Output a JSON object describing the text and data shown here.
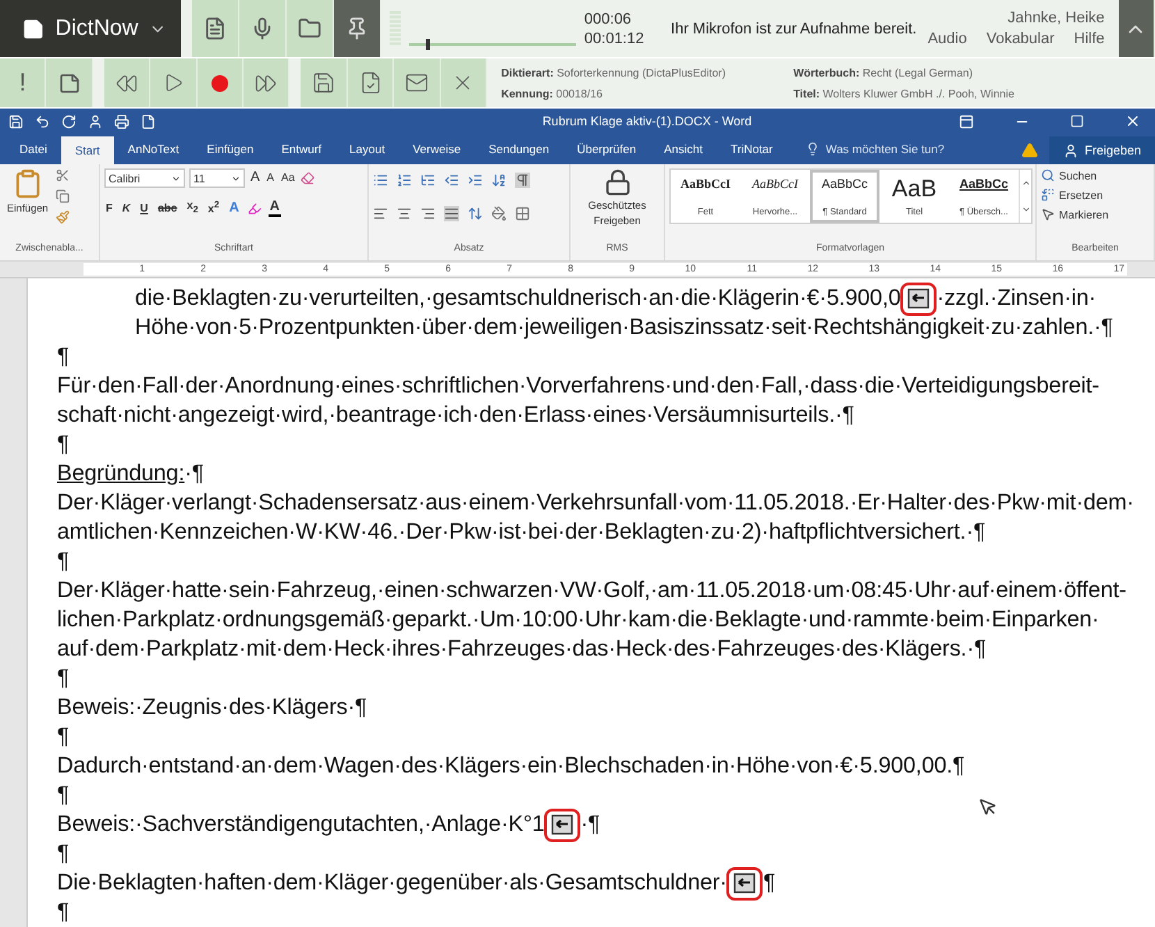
{
  "dictnow": {
    "app_name": "DictNow",
    "pin_active": true,
    "playback": {
      "level": 0.1
    },
    "time_elapsed": "000:06",
    "time_total": "00:01:12",
    "status": "Ihr Mikrofon ist zur Aufnahme bereit.",
    "user": "Jahnke, Heike",
    "menu": [
      "Audio",
      "Vokabular",
      "Hilfe"
    ],
    "priority": "!",
    "info": [
      {
        "label": "Diktierart:",
        "value": "Soforterkennung (DictaPlusEditor)"
      },
      {
        "label": "Wörterbuch:",
        "value": "Recht (Legal German)"
      },
      {
        "label": "Kennung:",
        "value": "00018/16"
      },
      {
        "label": "Titel:",
        "value": "Wolters Kluwer GmbH ./. Pooh, Winnie"
      }
    ]
  },
  "word": {
    "title": "Rubrum Klage aktiv-(1).DOCX - Word",
    "tabs": [
      {
        "label": "Datei",
        "selected": false
      },
      {
        "label": "Start",
        "selected": true
      },
      {
        "label": "AnNoText",
        "selected": false
      },
      {
        "label": "Einfügen",
        "selected": false
      },
      {
        "label": "Entwurf",
        "selected": false
      },
      {
        "label": "Layout",
        "selected": false
      },
      {
        "label": "Verweise",
        "selected": false
      },
      {
        "label": "Sendungen",
        "selected": false
      },
      {
        "label": "Überprüfen",
        "selected": false
      },
      {
        "label": "Ansicht",
        "selected": false
      },
      {
        "label": "TriNotar",
        "selected": false
      }
    ],
    "tell_me": "Was möchten Sie tun?",
    "share": "Freigeben",
    "paste": "Einfügen",
    "font": "Calibri",
    "size": "11",
    "case_button": "Aa",
    "grow": "A",
    "shrink": "A",
    "format_buttons": [
      "F",
      "K",
      "U",
      "abc",
      "x$_{2}$",
      "x$^{2}$"
    ],
    "effect_letter": "A",
    "color_letter": "A",
    "rms": [
      "Geschütztes",
      "Freigeben"
    ],
    "styles": [
      {
        "kind": "bold",
        "preview": "AaBbCcI",
        "name": "Fett",
        "selected": false
      },
      {
        "kind": "italic",
        "preview": "AaBbCcI",
        "name": "Hervorhe...",
        "selected": false
      },
      {
        "kind": "normal",
        "preview": "AaBbCc",
        "name": "¶ Standard",
        "selected": true
      },
      {
        "kind": "title",
        "preview": "AaB",
        "name": "Titel",
        "selected": false
      },
      {
        "kind": "heading",
        "preview": "AaBbCc",
        "name": "¶ Übersch...",
        "selected": false
      }
    ],
    "edit": [
      "Suchen",
      "Ersetzen",
      "Markieren"
    ],
    "groups": [
      "Zwischenabla...",
      "Schriftart",
      "Absatz",
      "RMS",
      "Formatvorlagen",
      "Bearbeiten"
    ],
    "ruler": [
      "1",
      "2",
      "3",
      "4",
      "5",
      "6",
      "7",
      "8",
      "9",
      "10",
      "11",
      "12",
      "13",
      "14",
      "15",
      "16",
      "17"
    ]
  },
  "document": {
    "lines": [
      {
        "indent": true,
        "parts": [
          {
            "kind": "text",
            "text": "die·Beklagten·zu·verurteilten,·gesamtschuldnerisch·an·die·Klägerin·€·5.900,0"
          },
          {
            "kind": "marker"
          },
          {
            "kind": "text",
            "text": "·zzgl.·Zinsen·in·"
          }
        ]
      },
      {
        "indent": true,
        "parts": [
          {
            "kind": "text",
            "text": "Höhe·von·5·Prozentpunkten·über·dem·jeweiligen·Basiszinssatz·seit·Rechtshängigkeit·zu·zahlen.·¶"
          }
        ]
      },
      {
        "indent": false,
        "parts": [
          {
            "kind": "text",
            "text": "¶"
          }
        ]
      },
      {
        "indent": false,
        "parts": [
          {
            "kind": "text",
            "text": "Für·den·Fall·der·Anordnung·eines·schriftlichen·Vorverfahrens·und·den·Fall,·dass·die·Verteidigungsbereit-"
          }
        ]
      },
      {
        "indent": false,
        "parts": [
          {
            "kind": "text",
            "text": "schaft·nicht·angezeigt·wird,·beantrage·ich·den·Erlass·eines·Versäumnisurteils.·¶"
          }
        ]
      },
      {
        "indent": false,
        "parts": [
          {
            "kind": "text",
            "text": "¶"
          }
        ]
      },
      {
        "indent": false,
        "parts": [
          {
            "kind": "underline",
            "text": "Begründung:"
          },
          {
            "kind": "text",
            "text": "·¶"
          }
        ]
      },
      {
        "indent": false,
        "parts": [
          {
            "kind": "text",
            "text": "Der·Kläger·verlangt·Schadensersatz·aus·einem·Verkehrsunfall·vom·11.05.2018.·Er·Halter·des·Pkw·mit·dem·"
          }
        ]
      },
      {
        "indent": false,
        "parts": [
          {
            "kind": "text",
            "text": "amtlichen·Kennzeichen·W·KW·46.·Der·Pkw·ist·bei·der·Beklagten·zu·2)·haftpflichtversichert.·¶"
          }
        ]
      },
      {
        "indent": false,
        "parts": [
          {
            "kind": "text",
            "text": "¶"
          }
        ]
      },
      {
        "indent": false,
        "parts": [
          {
            "kind": "text",
            "text": "Der·Kläger·hatte·sein·Fahrzeug,·einen·schwarzen·VW·Golf,·am·11.05.2018·um·08:45·Uhr·auf·einem·öffent-"
          }
        ]
      },
      {
        "indent": false,
        "parts": [
          {
            "kind": "text",
            "text": "lichen·Parkplatz·ordnungsgemäß·geparkt.·Um·10:00·Uhr·kam·die·Beklagte·und·rammte·beim·Einparken·"
          }
        ]
      },
      {
        "indent": false,
        "parts": [
          {
            "kind": "text",
            "text": "auf·dem·Parkplatz·mit·dem·Heck·ihres·Fahrzeuges·das·Heck·des·Fahrzeuges·des·Klägers.·¶"
          }
        ]
      },
      {
        "indent": false,
        "parts": [
          {
            "kind": "text",
            "text": "¶"
          }
        ]
      },
      {
        "indent": false,
        "parts": [
          {
            "kind": "text",
            "text": "Beweis:·Zeugnis·des·Klägers·¶"
          }
        ]
      },
      {
        "indent": false,
        "parts": [
          {
            "kind": "text",
            "text": "¶"
          }
        ]
      },
      {
        "indent": false,
        "parts": [
          {
            "kind": "text",
            "text": "Dadurch·entstand·an·dem·Wagen·des·Klägers·ein·Blechschaden·in·Höhe·von·€·5.900,00.¶"
          }
        ]
      },
      {
        "indent": false,
        "parts": [
          {
            "kind": "text",
            "text": "¶"
          }
        ]
      },
      {
        "indent": false,
        "parts": [
          {
            "kind": "text",
            "text": "Beweis:·Sachverständigengutachten,·Anlage·K°1"
          },
          {
            "kind": "marker"
          },
          {
            "kind": "text",
            "text": "·¶"
          }
        ]
      },
      {
        "indent": false,
        "parts": [
          {
            "kind": "text",
            "text": "¶"
          }
        ]
      },
      {
        "indent": false,
        "parts": [
          {
            "kind": "text",
            "text": "Die·Beklagten·haften·dem·Kläger·gegenüber·als·Gesamtschuldner·"
          },
          {
            "kind": "marker"
          },
          {
            "kind": "text",
            "text": "¶"
          }
        ]
      },
      {
        "indent": false,
        "parts": [
          {
            "kind": "text",
            "text": "¶"
          }
        ]
      }
    ]
  }
}
